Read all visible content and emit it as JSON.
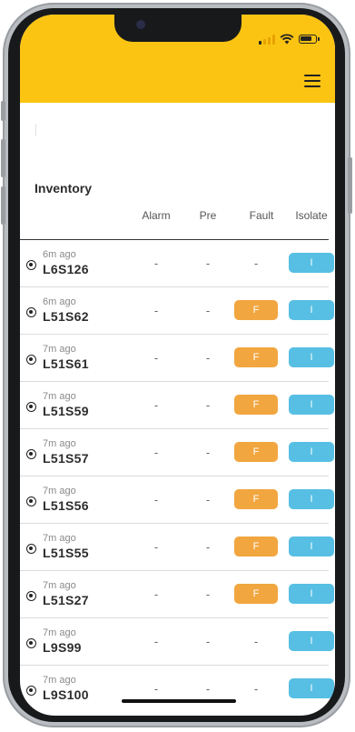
{
  "status_bar": {
    "signal_icon": "signal-icon",
    "wifi_icon": "wifi-icon",
    "battery_icon": "battery-icon"
  },
  "header": {
    "menu_icon": "hamburger-menu-icon",
    "background_color": "#fbc412"
  },
  "inventory": {
    "title": "Inventory",
    "columns": [
      "Alarm",
      "Pre",
      "Fault",
      "Isolate"
    ],
    "rows": [
      {
        "ago": "6m ago",
        "code": "L6S126",
        "alarm": "-",
        "pre": "-",
        "fault": "-",
        "isolate": "I"
      },
      {
        "ago": "6m ago",
        "code": "L51S62",
        "alarm": "-",
        "pre": "-",
        "fault": "F",
        "isolate": "I"
      },
      {
        "ago": "7m ago",
        "code": "L51S61",
        "alarm": "-",
        "pre": "-",
        "fault": "F",
        "isolate": "I"
      },
      {
        "ago": "7m ago",
        "code": "L51S59",
        "alarm": "-",
        "pre": "-",
        "fault": "F",
        "isolate": "I"
      },
      {
        "ago": "7m ago",
        "code": "L51S57",
        "alarm": "-",
        "pre": "-",
        "fault": "F",
        "isolate": "I"
      },
      {
        "ago": "7m ago",
        "code": "L51S56",
        "alarm": "-",
        "pre": "-",
        "fault": "F",
        "isolate": "I"
      },
      {
        "ago": "7m ago",
        "code": "L51S55",
        "alarm": "-",
        "pre": "-",
        "fault": "F",
        "isolate": "I"
      },
      {
        "ago": "7m ago",
        "code": "L51S27",
        "alarm": "-",
        "pre": "-",
        "fault": "F",
        "isolate": "I"
      },
      {
        "ago": "7m ago",
        "code": "L9S99",
        "alarm": "-",
        "pre": "-",
        "fault": "-",
        "isolate": "I"
      },
      {
        "ago": "7m ago",
        "code": "L9S100",
        "alarm": "-",
        "pre": "-",
        "fault": "-",
        "isolate": "I"
      }
    ]
  },
  "colors": {
    "fault_badge": "#f1a640",
    "isolate_badge": "#57bfe3"
  }
}
